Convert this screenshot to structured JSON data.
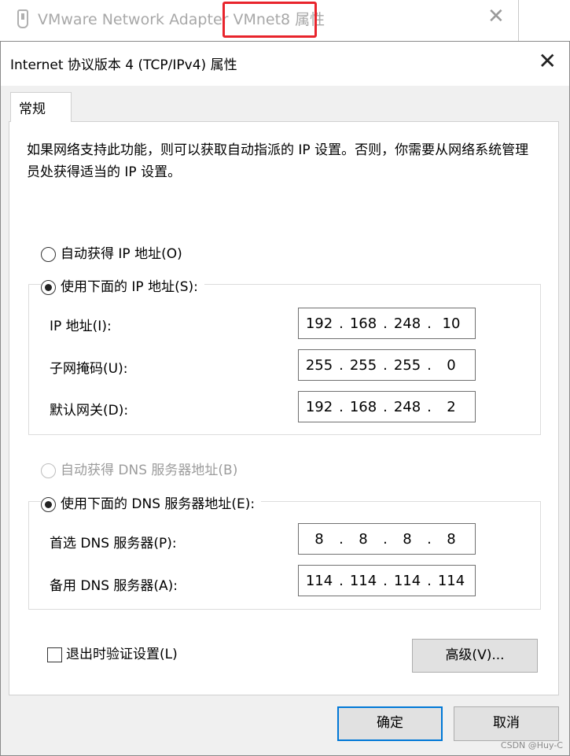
{
  "background_window": {
    "title": "VMware Network Adapter VMnet8 属性",
    "close": "✕"
  },
  "dialog": {
    "title": "Internet 协议版本 4 (TCP/IPv4) 属性",
    "close": "✕",
    "tab": "常规",
    "description": "如果网络支持此功能，则可以获取自动指派的 IP 设置。否则，你需要从网络系统管理员处获得适当的 IP 设置。",
    "ip_section": {
      "auto_label": "自动获得 IP 地址(O)",
      "manual_label": "使用下面的 IP 地址(S):",
      "selected": "manual",
      "fields": [
        {
          "label": "IP 地址(I):",
          "octets": [
            "192",
            "168",
            "248",
            "10"
          ]
        },
        {
          "label": "子网掩码(U):",
          "octets": [
            "255",
            "255",
            "255",
            "0"
          ]
        },
        {
          "label": "默认网关(D):",
          "octets": [
            "192",
            "168",
            "248",
            "2"
          ]
        }
      ]
    },
    "dns_section": {
      "auto_label": "自动获得 DNS 服务器地址(B)",
      "manual_label": "使用下面的 DNS 服务器地址(E):",
      "selected": "manual",
      "fields": [
        {
          "label": "首选 DNS 服务器(P):",
          "octets": [
            "8",
            "8",
            "8",
            "8"
          ]
        },
        {
          "label": "备用 DNS 服务器(A):",
          "octets": [
            "114",
            "114",
            "114",
            "114"
          ]
        }
      ]
    },
    "validate_label": "退出时验证设置(L)",
    "validate_checked": false,
    "advanced_button": "高级(V)...",
    "ok_button": "确定",
    "cancel_button": "取消"
  },
  "watermark": "CSDN @Huy-C",
  "colors": {
    "highlight": "#e8242c",
    "default_button_border": "#0078d7"
  }
}
